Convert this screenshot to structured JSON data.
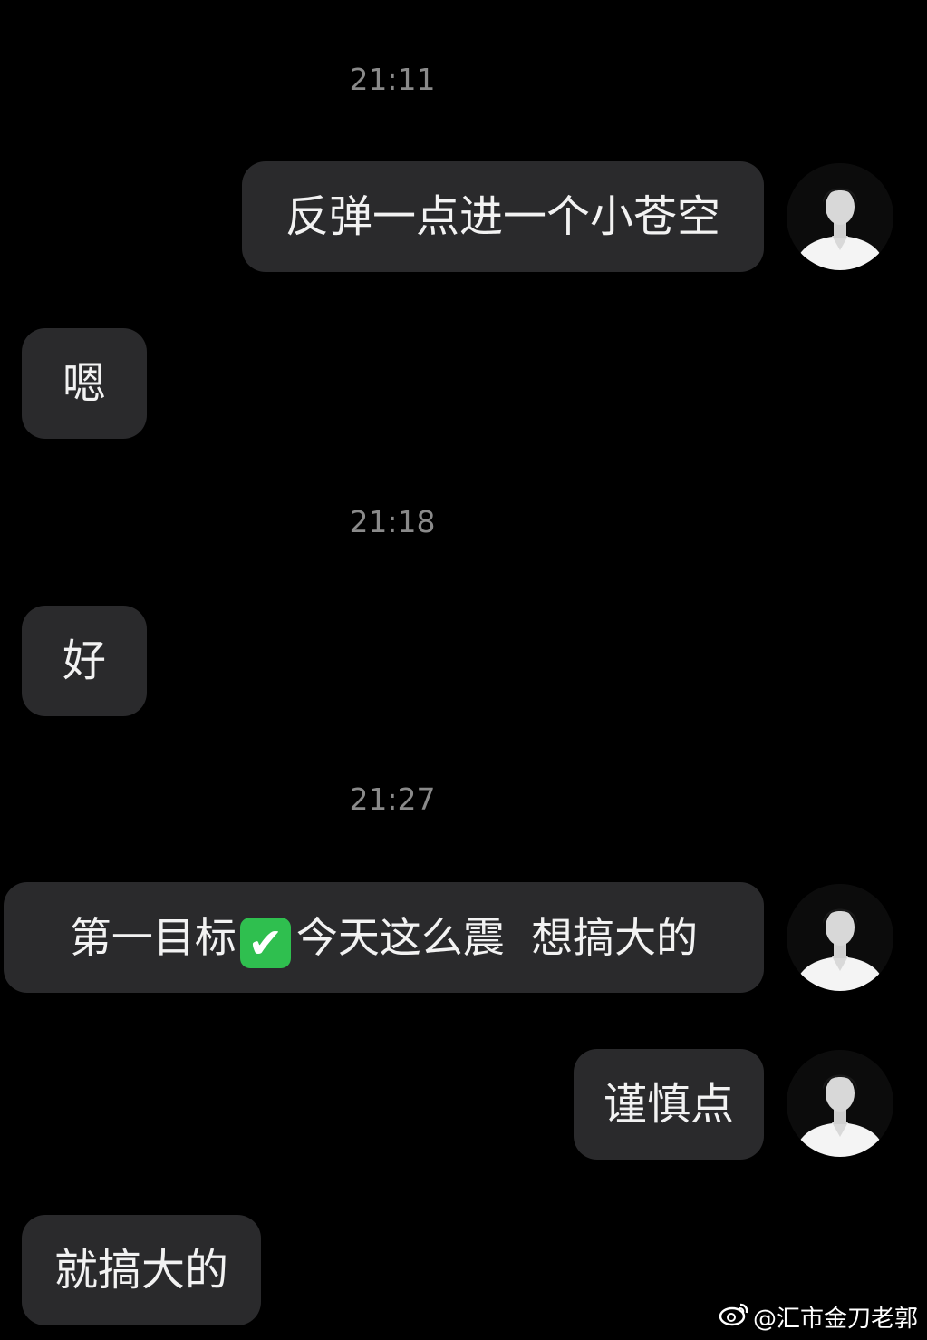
{
  "timestamps": [
    "21:11",
    "21:18",
    "21:27"
  ],
  "messages": [
    {
      "side": "right",
      "text": "反弹一点进一个小苍空"
    },
    {
      "side": "left",
      "text": "嗯"
    },
    {
      "side": "left",
      "text": "好"
    },
    {
      "side": "right",
      "text_before": "第一目标",
      "emoji": "✔",
      "text_after": "今天这么震  想搞大的"
    },
    {
      "side": "right",
      "text": "谨慎点"
    },
    {
      "side": "left",
      "text": "就搞大的"
    }
  ],
  "avatar_icon": "user-avatar-icon",
  "colors": {
    "background": "#000000",
    "bubble": "#2a2a2c",
    "bubble_text": "#f2f2f2",
    "timestamp": "#8a8a8a",
    "check": "#2fbf4f"
  },
  "watermark": {
    "icon": "weibo-icon",
    "text": "@汇市金刀老郭"
  }
}
